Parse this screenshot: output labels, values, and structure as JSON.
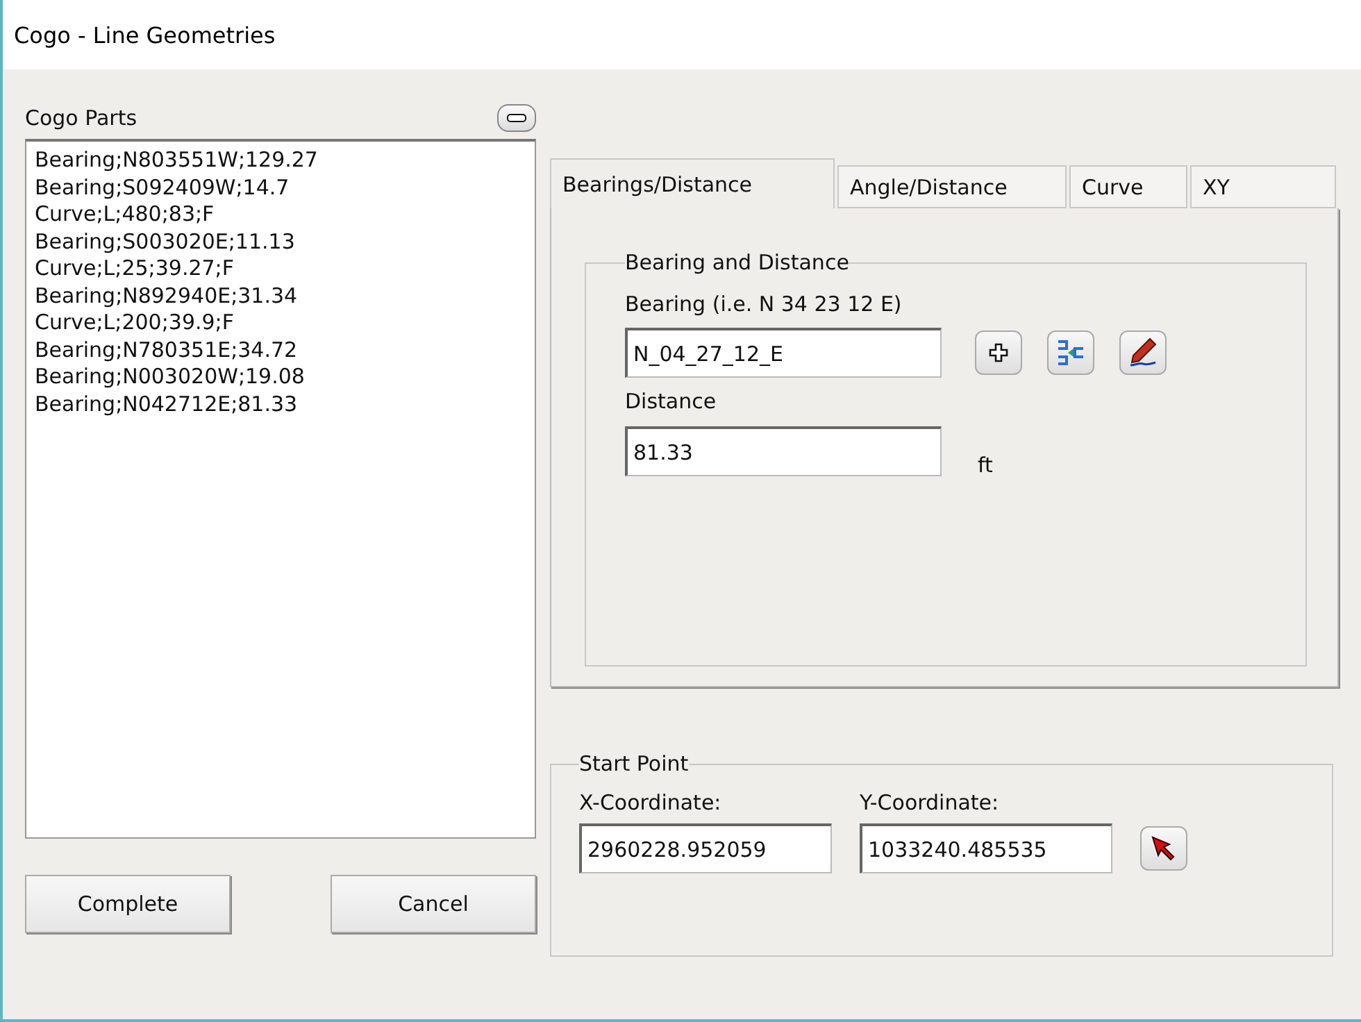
{
  "window": {
    "title": "Cogo - Line Geometries"
  },
  "cogo_parts": {
    "label": "Cogo Parts",
    "items": [
      "Bearing;N803551W;129.27",
      "Bearing;S092409W;14.7",
      "Curve;L;480;83;F",
      "Bearing;S003020E;11.13",
      "Curve;L;25;39.27;F",
      "Bearing;N892940E;31.34",
      "Curve;L;200;39.9;F",
      "Bearing;N780351E;34.72",
      "Bearing;N003020W;19.08",
      "Bearing;N042712E;81.33"
    ]
  },
  "tabs": [
    {
      "label": "Bearings/Distance",
      "selected": true
    },
    {
      "label": "Angle/Distance",
      "selected": false
    },
    {
      "label": "Curve",
      "selected": false
    },
    {
      "label": "XY",
      "selected": false
    }
  ],
  "bearing_group": {
    "title": "Bearing and Distance",
    "bearing_label": "Bearing (i.e. N 34 23 12 E)",
    "bearing_value": "N_04_27_12_E",
    "distance_label": "Distance",
    "distance_value": "81.33",
    "unit": "ft"
  },
  "start_point": {
    "title": "Start Point",
    "x_label": "X-Coordinate:",
    "x_value": "2960228.952059",
    "y_label": "Y-Coordinate:",
    "y_value": "1033240.485535"
  },
  "buttons": [
    "Complete",
    "Cancel"
  ]
}
